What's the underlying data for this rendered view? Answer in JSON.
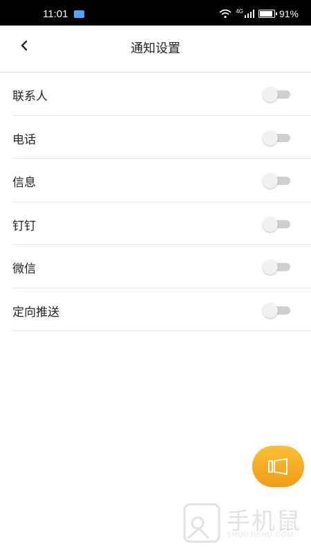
{
  "status_bar": {
    "time": "11:01",
    "signal_label": "4G",
    "battery_percent": "91%",
    "battery_level": 0.91
  },
  "header": {
    "title": "通知设置",
    "back_icon": "chevron-left-icon"
  },
  "settings": [
    {
      "label": "联系人",
      "enabled": false
    },
    {
      "label": "电话",
      "enabled": false
    },
    {
      "label": "信息",
      "enabled": false
    },
    {
      "label": "钉钉",
      "enabled": false
    },
    {
      "label": "微信",
      "enabled": false
    },
    {
      "label": "定向推送",
      "enabled": false
    }
  ],
  "float_button": {
    "icon": "speaker-icon",
    "color": "#f5a623"
  },
  "watermark": {
    "text": "手机鼠",
    "subtext": "SHOUJISHU.COM"
  }
}
